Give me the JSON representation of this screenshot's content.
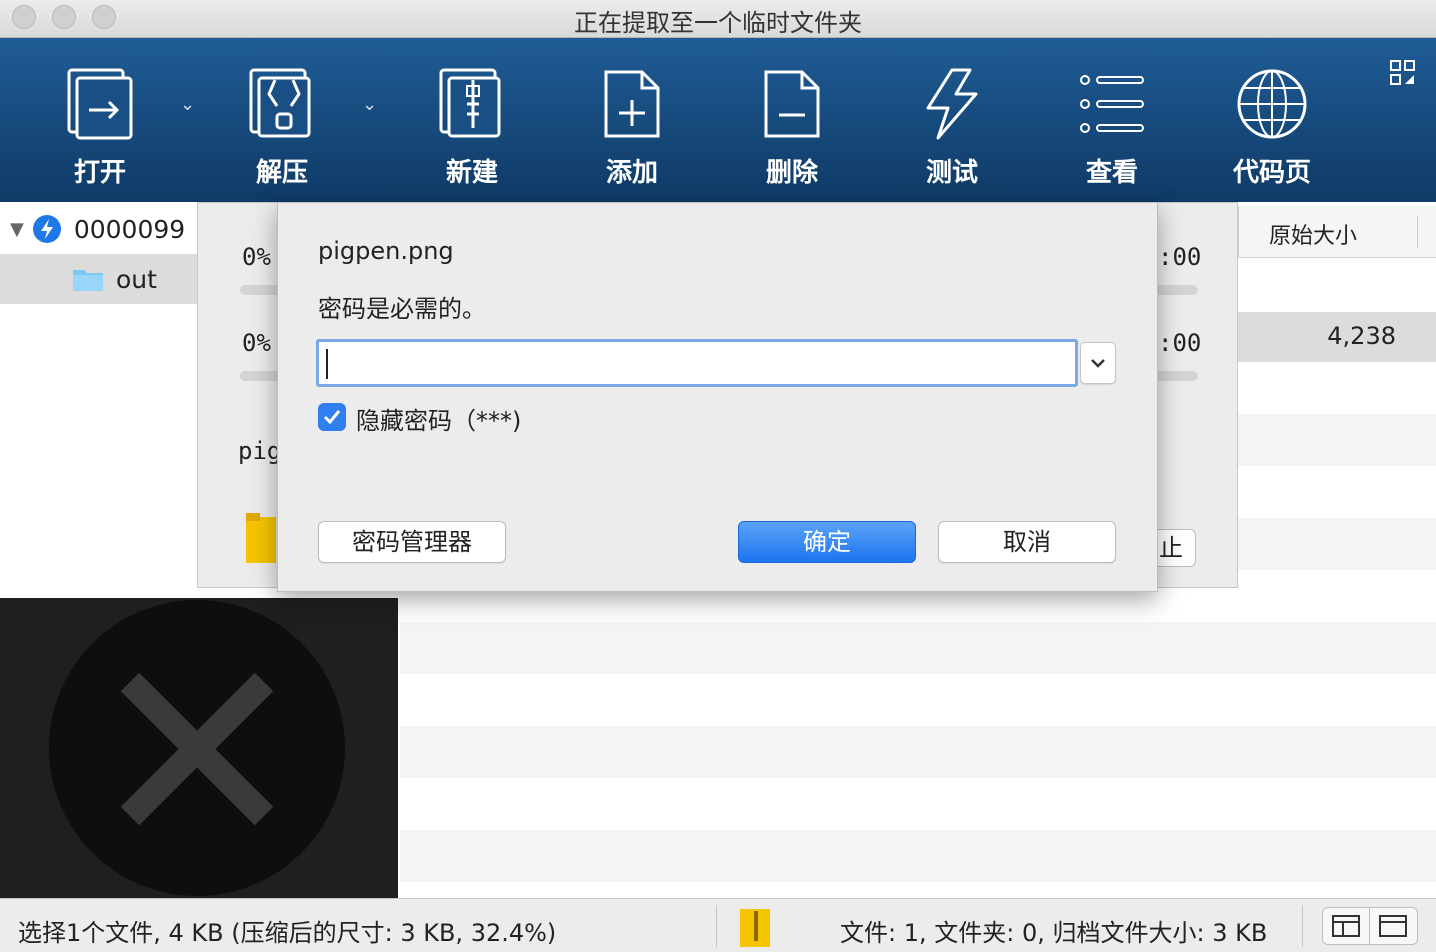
{
  "window": {
    "title": "正在提取至一个临时文件夹"
  },
  "toolbar": {
    "open": "打开",
    "extract": "解压",
    "new": "新建",
    "add": "添加",
    "delete": "删除",
    "test": "测试",
    "view": "查看",
    "codepage": "代码页"
  },
  "tree": {
    "archive_name": "0000099",
    "folder_name": "out"
  },
  "list": {
    "col_original_size": "原始大小",
    "row_size": "4,238"
  },
  "progress": {
    "pct_1": "0%",
    "pct_2": "0%",
    "time_1": ":00",
    "time_2": ":00",
    "file_fragment": "pig",
    "button_fragment": "止"
  },
  "dialog": {
    "filename": "pigpen.png",
    "message": "密码是必需的。",
    "password_value": "",
    "hide_password_label": "隐藏密码（***)",
    "hide_password_checked": true,
    "manager_button": "密码管理器",
    "ok_button": "确定",
    "cancel_button": "取消"
  },
  "status": {
    "selection": "选择1个文件, 4 KB (压缩后的尺寸: 3 KB, 32.4%)",
    "summary": "文件: 1, 文件夹: 0, 归档文件大小: 3 KB"
  },
  "colors": {
    "toolbar_top": "#1f5c96",
    "toolbar_bottom": "#0f3a66",
    "accent": "#2f7ff0",
    "folder_yellow": "#f5c400"
  }
}
